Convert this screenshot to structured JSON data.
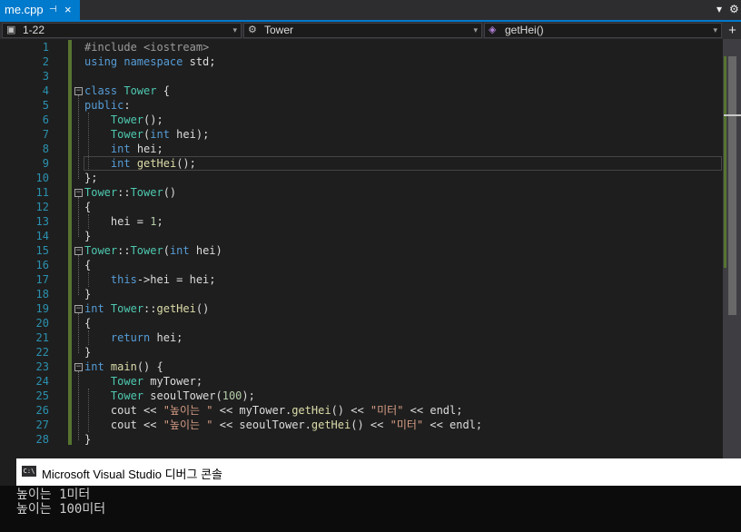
{
  "tab": {
    "label": "me.cpp",
    "pin": "⊣",
    "close": "×"
  },
  "window_controls": {
    "dropdown": "▾",
    "settings": "⚙"
  },
  "nav": {
    "scope": "1-22",
    "class": "Tower",
    "member": "getHei()",
    "arrow": "▾",
    "split": "+"
  },
  "code": {
    "line_numbers": [
      "1",
      "2",
      "3",
      "4",
      "5",
      "6",
      "7",
      "8",
      "9",
      "10",
      "11",
      "12",
      "13",
      "14",
      "15",
      "16",
      "17",
      "18",
      "19",
      "20",
      "21",
      "22",
      "23",
      "24",
      "25",
      "26",
      "27",
      "28"
    ],
    "lines": [
      [
        {
          "t": "#include <iostream>",
          "c": "pp"
        }
      ],
      [
        {
          "t": "using namespace",
          "c": "kw"
        },
        {
          "t": " std;",
          "c": ""
        }
      ],
      [],
      [
        {
          "t": "class",
          "c": "kw"
        },
        {
          "t": " ",
          "c": ""
        },
        {
          "t": "Tower",
          "c": "ty"
        },
        {
          "t": " {",
          "c": ""
        }
      ],
      [
        {
          "t": "public",
          "c": "kw"
        },
        {
          "t": ":",
          "c": ""
        }
      ],
      [
        {
          "t": "    ",
          "c": ""
        },
        {
          "t": "Tower",
          "c": "ty"
        },
        {
          "t": "();",
          "c": ""
        }
      ],
      [
        {
          "t": "    ",
          "c": ""
        },
        {
          "t": "Tower",
          "c": "ty"
        },
        {
          "t": "(",
          "c": ""
        },
        {
          "t": "int",
          "c": "kw"
        },
        {
          "t": " hei);",
          "c": ""
        }
      ],
      [
        {
          "t": "    ",
          "c": ""
        },
        {
          "t": "int",
          "c": "kw"
        },
        {
          "t": " hei;",
          "c": ""
        }
      ],
      [
        {
          "t": "    ",
          "c": ""
        },
        {
          "t": "int",
          "c": "kw"
        },
        {
          "t": " ",
          "c": ""
        },
        {
          "t": "getHei",
          "c": "fn"
        },
        {
          "t": "();",
          "c": ""
        }
      ],
      [
        {
          "t": "};",
          "c": ""
        }
      ],
      [
        {
          "t": "Tower",
          "c": "ty"
        },
        {
          "t": "::",
          "c": ""
        },
        {
          "t": "Tower",
          "c": "ty"
        },
        {
          "t": "()",
          "c": ""
        }
      ],
      [
        {
          "t": "{",
          "c": ""
        }
      ],
      [
        {
          "t": "    hei = ",
          "c": ""
        },
        {
          "t": "1",
          "c": "nm"
        },
        {
          "t": ";",
          "c": ""
        }
      ],
      [
        {
          "t": "}",
          "c": ""
        }
      ],
      [
        {
          "t": "Tower",
          "c": "ty"
        },
        {
          "t": "::",
          "c": ""
        },
        {
          "t": "Tower",
          "c": "ty"
        },
        {
          "t": "(",
          "c": ""
        },
        {
          "t": "int",
          "c": "kw"
        },
        {
          "t": " hei)",
          "c": ""
        }
      ],
      [
        {
          "t": "{",
          "c": ""
        }
      ],
      [
        {
          "t": "    ",
          "c": ""
        },
        {
          "t": "this",
          "c": "kw"
        },
        {
          "t": "->hei = hei;",
          "c": ""
        }
      ],
      [
        {
          "t": "}",
          "c": ""
        }
      ],
      [
        {
          "t": "int",
          "c": "kw"
        },
        {
          "t": " ",
          "c": ""
        },
        {
          "t": "Tower",
          "c": "ty"
        },
        {
          "t": "::",
          "c": ""
        },
        {
          "t": "getHei",
          "c": "fn"
        },
        {
          "t": "()",
          "c": ""
        }
      ],
      [
        {
          "t": "{",
          "c": ""
        }
      ],
      [
        {
          "t": "    ",
          "c": ""
        },
        {
          "t": "return",
          "c": "kw"
        },
        {
          "t": " hei;",
          "c": ""
        }
      ],
      [
        {
          "t": "}",
          "c": ""
        }
      ],
      [
        {
          "t": "int",
          "c": "kw"
        },
        {
          "t": " ",
          "c": ""
        },
        {
          "t": "main",
          "c": "fn"
        },
        {
          "t": "() {",
          "c": ""
        }
      ],
      [
        {
          "t": "    ",
          "c": ""
        },
        {
          "t": "Tower",
          "c": "ty"
        },
        {
          "t": " myTower;",
          "c": ""
        }
      ],
      [
        {
          "t": "    ",
          "c": ""
        },
        {
          "t": "Tower",
          "c": "ty"
        },
        {
          "t": " seoulTower(",
          "c": ""
        },
        {
          "t": "100",
          "c": "nm"
        },
        {
          "t": ");",
          "c": ""
        }
      ],
      [
        {
          "t": "    cout << ",
          "c": ""
        },
        {
          "t": "\"높이는 \"",
          "c": "st"
        },
        {
          "t": " << myTower.",
          "c": ""
        },
        {
          "t": "getHei",
          "c": "fn"
        },
        {
          "t": "() << ",
          "c": ""
        },
        {
          "t": "\"미터\"",
          "c": "st"
        },
        {
          "t": " << endl;",
          "c": ""
        }
      ],
      [
        {
          "t": "    cout << ",
          "c": ""
        },
        {
          "t": "\"높이는 \"",
          "c": "st"
        },
        {
          "t": " << seoulTower.",
          "c": ""
        },
        {
          "t": "getHei",
          "c": "fn"
        },
        {
          "t": "() << ",
          "c": ""
        },
        {
          "t": "\"미터\"",
          "c": "st"
        },
        {
          "t": " << endl;",
          "c": ""
        }
      ],
      [
        {
          "t": "}",
          "c": ""
        }
      ]
    ],
    "fold_lines": [
      4,
      11,
      15,
      19,
      23
    ]
  },
  "console": {
    "title": "Microsoft Visual Studio 디버그 콘솔",
    "icon_text": "C:\\",
    "output": [
      "높이는 1미터",
      "높이는 100미터"
    ]
  }
}
